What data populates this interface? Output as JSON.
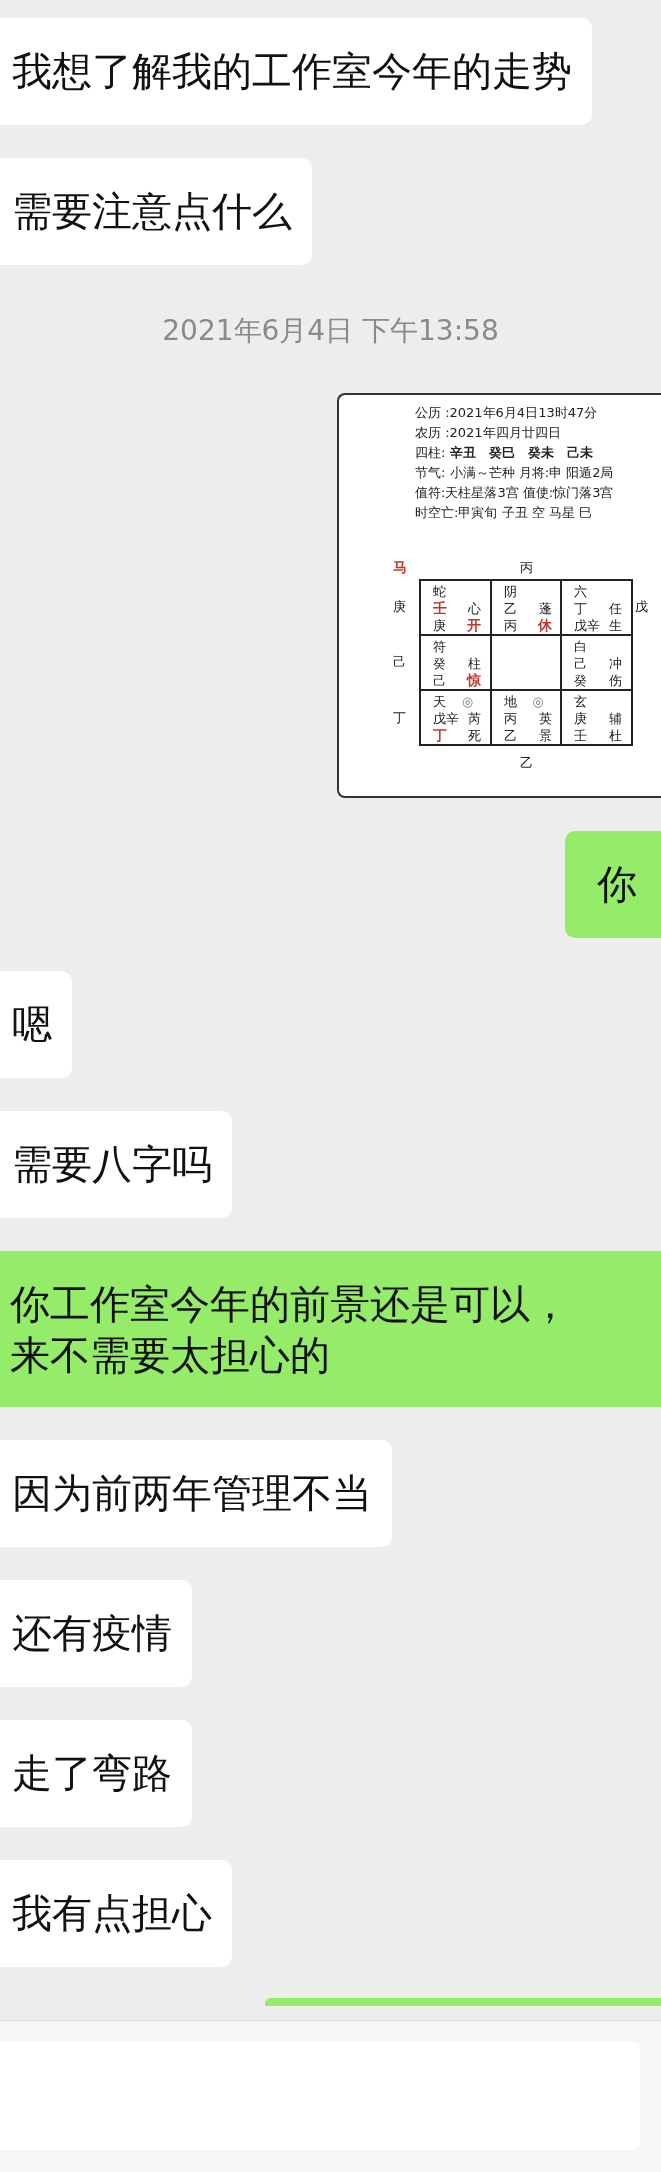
{
  "messages": [
    {
      "kind": "received",
      "lines": [
        "我想了解我的工作室今年的走势"
      ]
    },
    {
      "kind": "received",
      "lines": [
        "需要注意点什么"
      ]
    },
    {
      "kind": "time",
      "text": "2021年6月4日 下午13:58"
    },
    {
      "kind": "image",
      "card": {
        "info": [
          "公历 :2021年6月4日13时47分",
          "农历 :2021年四月廿四日",
          "四柱: **辛丑　癸巳　癸未　己未**",
          "节气: 小满～芒种 月将:申 阳遁2局",
          "值符:天柱星落3宫 值使:惊门落3宫",
          "时空亡:甲寅旬 子丑 空 马星 巳"
        ],
        "corner": {
          "t": "马",
          "color": "#c0392b"
        },
        "top": "丙",
        "bottom": "乙",
        "left": [
          "庚",
          "己",
          "丁"
        ],
        "right": [
          "戊"
        ],
        "cells": [
          {
            "rows": [
              [
                {
                  "t": "蛇"
                }
              ],
              [
                {
                  "t": "壬",
                  "color": "#c0392b"
                },
                {
                  "t": "心"
                }
              ],
              [
                {
                  "t": "庚"
                },
                {
                  "t": "开",
                  "color": "#c0392b"
                }
              ]
            ]
          },
          {
            "rows": [
              [
                {
                  "t": "阴"
                }
              ],
              [
                {
                  "t": "乙"
                },
                {
                  "t": "蓬"
                }
              ],
              [
                {
                  "t": "丙"
                },
                {
                  "t": "休",
                  "color": "#c0392b"
                }
              ]
            ]
          },
          {
            "rows": [
              [
                {
                  "t": "六"
                }
              ],
              [
                {
                  "t": "丁"
                },
                {
                  "t": "任"
                }
              ],
              [
                {
                  "t": "戊辛"
                },
                {
                  "t": "生"
                }
              ]
            ]
          },
          {
            "rows": [
              [
                {
                  "t": "符"
                }
              ],
              [
                {
                  "t": "癸"
                },
                {
                  "t": "柱"
                }
              ],
              [
                {
                  "t": "己"
                },
                {
                  "t": "惊",
                  "color": "#c0392b"
                }
              ]
            ]
          },
          {},
          {
            "rows": [
              [
                {
                  "t": "白"
                }
              ],
              [
                {
                  "t": "己"
                },
                {
                  "t": "冲"
                }
              ],
              [
                {
                  "t": "癸"
                },
                {
                  "t": "伤"
                }
              ]
            ]
          },
          {
            "rows": [
              [
                {
                  "t": "天"
                },
                {
                  "t": "◎"
                }
              ],
              [
                {
                  "t": "戊辛"
                },
                {
                  "t": "芮"
                }
              ],
              [
                {
                  "t": "丁",
                  "color": "#c0392b"
                },
                {
                  "t": "死"
                }
              ]
            ]
          },
          {
            "rows": [
              [
                {
                  "t": "地"
                },
                {
                  "t": "◎"
                }
              ],
              [
                {
                  "t": "丙"
                },
                {
                  "t": "英"
                }
              ],
              [
                {
                  "t": "乙"
                },
                {
                  "t": "景"
                }
              ]
            ]
          },
          {
            "rows": [
              [
                {
                  "t": "玄"
                }
              ],
              [
                {
                  "t": "庚"
                },
                {
                  "t": "辅"
                }
              ],
              [
                {
                  "t": "壬"
                },
                {
                  "t": "杜"
                }
              ]
            ]
          }
        ]
      }
    },
    {
      "kind": "sent",
      "lines": [
        "你"
      ]
    },
    {
      "kind": "received",
      "lines": [
        "嗯"
      ]
    },
    {
      "kind": "received",
      "lines": [
        "需要八字吗"
      ]
    },
    {
      "kind": "sent",
      "wide": true,
      "lines": [
        "你工作室今年的前景还是可以，",
        "来不需要太担心的"
      ]
    },
    {
      "kind": "received",
      "lines": [
        "因为前两年管理不当"
      ]
    },
    {
      "kind": "received",
      "lines": [
        "还有疫情"
      ]
    },
    {
      "kind": "received",
      "lines": [
        "走了弯路"
      ]
    },
    {
      "kind": "received",
      "lines": [
        "我有点担心"
      ]
    },
    {
      "kind": "peek"
    }
  ]
}
